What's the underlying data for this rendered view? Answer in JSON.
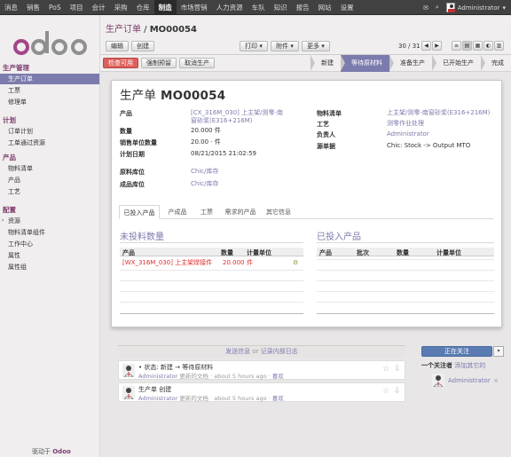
{
  "topnav": {
    "items": [
      "消息",
      "销售",
      "PoS",
      "项目",
      "会计",
      "采购",
      "仓库",
      "制造",
      "市场营销",
      "人力资源",
      "车队",
      "知识",
      "报告",
      "网站",
      "设置"
    ],
    "active_index": 7,
    "user": "Administrator"
  },
  "sidebar": {
    "logo": "odoo",
    "sections": [
      {
        "title": "生产管理",
        "items": [
          "生产订单",
          "工票",
          "修理单"
        ]
      },
      {
        "title": "计划",
        "items": [
          "订单计划",
          "工单通过资源"
        ]
      },
      {
        "title": "产品",
        "items": [
          "物料清单",
          "产品",
          "工艺"
        ]
      },
      {
        "title": "配置",
        "items": [
          "资源",
          "物料清单组件",
          "工作中心",
          "属性",
          "属性组"
        ]
      }
    ],
    "active_item": "生产订单",
    "powered_by": "驱动于",
    "powered_brand": "Odoo"
  },
  "breadcrumb": {
    "parent": "生产订单",
    "separator": " / ",
    "current": "MO00054"
  },
  "toolbar": {
    "edit": "编辑",
    "create": "创建",
    "print": "打印 ▾",
    "attachment": "附件 ▾",
    "more": "更多 ▾",
    "pager": "30 / 31"
  },
  "status": {
    "buttons": [
      "检查可用",
      "强制预留",
      "取消生产"
    ],
    "steps": [
      "新建",
      "等待原材料",
      "准备生产",
      "已开始生产",
      "完成"
    ],
    "current_step": "等待原材料"
  },
  "form": {
    "title_prefix": "生产单",
    "title": "MO00054",
    "fields_left": [
      {
        "label": "产品",
        "value": "[CX_316M_030] 上主架/测零-南窗砂浆(E316+216M)",
        "link": true
      },
      {
        "label": "数量",
        "value": "20.000 件",
        "link": false
      },
      {
        "label": "销售单位数量",
        "value": "20.00 · 件",
        "link": false
      },
      {
        "label": "计划日期",
        "value": "08/21/2015 21:02:59",
        "link": false
      },
      {
        "label": "原料库位",
        "value": "Chic/库存",
        "link": true
      },
      {
        "label": "成品库位",
        "value": "Chic/库存",
        "link": true
      }
    ],
    "fields_right": [
      {
        "label": "物料清单",
        "value": "上主架/测零-南窗砂浆(E316+216M)",
        "link": true
      },
      {
        "label": "工艺",
        "value": "测零作业处理",
        "link": true
      },
      {
        "label": "负责人",
        "value": "Administrator",
        "link": true
      },
      {
        "label": "源单据",
        "value": "Chic: Stock -> Output MTO",
        "link": false
      }
    ],
    "tabs": [
      "已投入产品",
      "产成品",
      "工票",
      "需求的产品",
      "其它信息"
    ],
    "active_tab": "已投入产品",
    "left_section": {
      "title": "未投料数量",
      "columns": [
        "产品",
        "数量",
        "计量单位"
      ],
      "rows": [
        {
          "product": "[WX_316M_030] 上主架焊接件",
          "qty": "20.000",
          "uom": "件"
        }
      ]
    },
    "right_section": {
      "title": "已投入产品",
      "columns": [
        "产品",
        "批次",
        "数量",
        "计量单位"
      ]
    }
  },
  "chatter": {
    "send": "发送信息",
    "or": "or",
    "log": "记录内部日志",
    "messages": [
      {
        "line1": "• 状态: 新建 → 等待原材料",
        "author": "Administrator",
        "action": "更新的文档",
        "time": "about 5 hours ago",
        "like": "喜欢"
      },
      {
        "line1": "生产单 创建",
        "author": "Administrator",
        "action": "更新的文档",
        "time": "about 5 hours ago",
        "like": "喜欢"
      }
    ],
    "follow_button": "正在关注",
    "followers_count": "一个关注者",
    "add_follower": "添加其它的",
    "follower": "Administrator"
  }
}
